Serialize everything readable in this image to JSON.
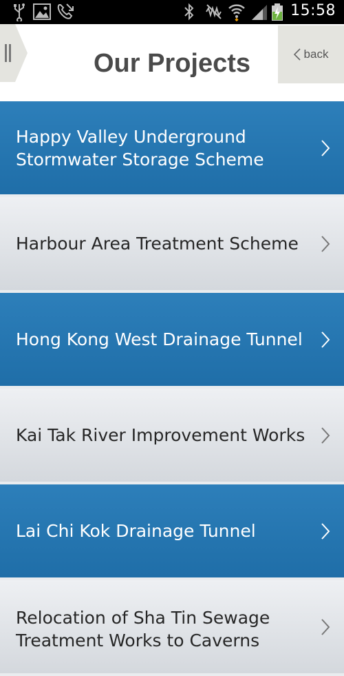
{
  "status_bar": {
    "time": "15:58",
    "icons": [
      "usb-icon",
      "image-icon",
      "missed-call-icon",
      "bluetooth-icon",
      "mute-icon",
      "wifi-icon",
      "signal-icon",
      "battery-charging-icon"
    ]
  },
  "header": {
    "title": "Our Projects",
    "back_label": "back",
    "menu_icon": "menu-handle-icon"
  },
  "projects": [
    {
      "label": "Happy Valley Underground Stormwater Storage Scheme"
    },
    {
      "label": "Harbour Area Treatment Scheme"
    },
    {
      "label": "Hong Kong West Drainage Tunnel"
    },
    {
      "label": "Kai Tak River Improvement Works"
    },
    {
      "label": "Lai Chi Kok Drainage Tunnel"
    },
    {
      "label": "Relocation of Sha Tin Sewage Treatment Works to Caverns"
    }
  ],
  "colors": {
    "blue_item": "#2277b0",
    "grey_item": "#e0e3e7",
    "title": "#4a4a4a",
    "back_bg": "#e4e4df"
  }
}
